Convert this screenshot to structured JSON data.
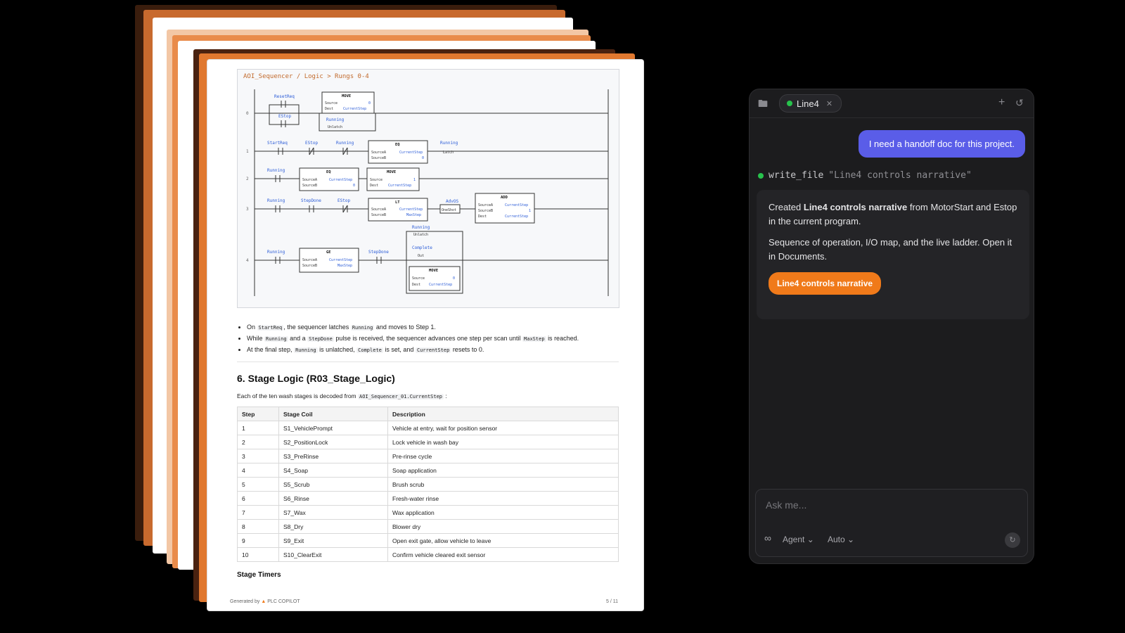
{
  "document": {
    "ladder": {
      "breadcrumb": "AOI_Sequencer / Logic > Rungs 0-4",
      "rung_numbers": [
        "0",
        "1",
        "2",
        "3",
        "4"
      ],
      "labels": {
        "reset_req": "ResetReq",
        "estop": "EStop",
        "running": "Running",
        "unlatch": "Unlatch",
        "start_req": "StartReq",
        "latch": "Latch",
        "step_done": "StepDone",
        "adv_os": "AdvOS",
        "oneshot": "OneShot",
        "complete": "Complete",
        "out": "Out",
        "move": "MOVE",
        "eq": "EQ",
        "lt": "LT",
        "add": "ADD",
        "ge": "GE",
        "source": "Source",
        "dest": "Dest",
        "source_a": "SourceA",
        "source_b": "SourceB",
        "current_step": "CurrentStep",
        "max_step": "MaxStep",
        "zero": "0",
        "one": "1"
      }
    },
    "bullets": [
      {
        "a": "On",
        "c1": "StartReq",
        "b": ", the sequencer latches",
        "c2": "Running",
        "d": "and moves to Step 1.",
        "c3": "",
        "e": ""
      },
      {
        "a": "While",
        "c1": "Running",
        "b": "and a",
        "c2": "StepDone",
        "d": "pulse is received, the sequencer advances one step per scan until",
        "c3": "MaxStep",
        "e": "is reached."
      },
      {
        "a": "At the final step,",
        "c1": "Running",
        "b": "is unlatched,",
        "c2": "Complete",
        "d": "is set, and",
        "c3": "CurrentStep",
        "e": "resets to 0."
      }
    ],
    "section_title": "6. Stage Logic (R03_Stage_Logic)",
    "section_intro": "Each of the ten wash stages is decoded from",
    "section_intro_code": "AOI_Sequencer_01.CurrentStep",
    "section_intro_end": ":",
    "table": {
      "headers": [
        "Step",
        "Stage Coil",
        "Description"
      ],
      "rows": [
        [
          "1",
          "S1_VehiclePrompt",
          "Vehicle at entry, wait for position sensor"
        ],
        [
          "2",
          "S2_PositionLock",
          "Lock vehicle in wash bay"
        ],
        [
          "3",
          "S3_PreRinse",
          "Pre-rinse cycle"
        ],
        [
          "4",
          "S4_Soap",
          "Soap application"
        ],
        [
          "5",
          "S5_Scrub",
          "Brush scrub"
        ],
        [
          "6",
          "S6_Rinse",
          "Fresh-water rinse"
        ],
        [
          "7",
          "S7_Wax",
          "Wax application"
        ],
        [
          "8",
          "S8_Dry",
          "Blower dry"
        ],
        [
          "9",
          "S9_Exit",
          "Open exit gate, allow vehicle to leave"
        ],
        [
          "10",
          "S10_ClearExit",
          "Confirm vehicle cleared exit sensor"
        ]
      ]
    },
    "subsection_title": "Stage Timers",
    "footer_left": "Generated by",
    "footer_brand": "PLC COPILOT",
    "footer_right": "5 / 11"
  },
  "chat": {
    "tab_label": "Line4",
    "user_message": "I need a handoff doc for this project.",
    "tool_name": "write_file",
    "tool_arg": "\"Line4 controls narrative\"",
    "response_pre": "Created",
    "response_bold": "Line4 controls narrative",
    "response_post": "from MotorStart and Estop in the current program.",
    "response_2": "Sequence of operation, I/O map, and the live ladder. Open it in Documents.",
    "open_button": "Line4 controls narrative",
    "composer_placeholder": "Ask me...",
    "mode_label": "Agent",
    "model_label": "Auto"
  },
  "colors": {
    "accent_orange": "#f07a1a",
    "user_bubble": "#5a5de8",
    "status_green": "#27c24c"
  }
}
